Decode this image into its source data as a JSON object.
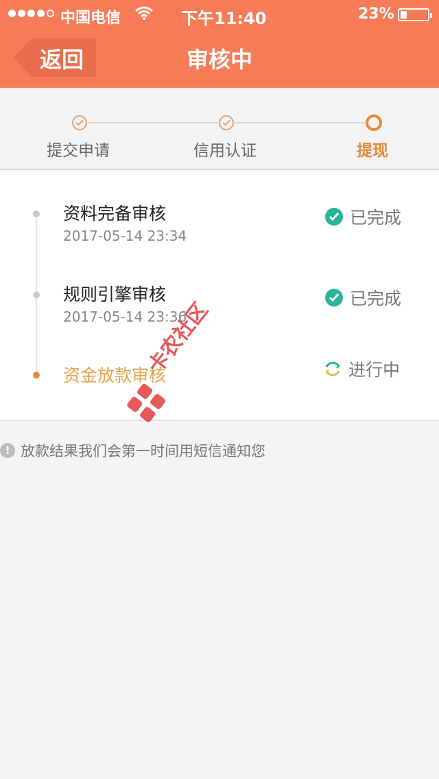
{
  "status_bar": {
    "carrier": "中国电信",
    "time": "下午11:40",
    "battery_pct": "23%",
    "battery_level": 0.23,
    "signal_bars": 4,
    "signal_total": 5
  },
  "nav": {
    "back_label": "返回",
    "title": "审核中"
  },
  "steps": [
    {
      "label": "提交申请",
      "state": "done"
    },
    {
      "label": "信用认证",
      "state": "done"
    },
    {
      "label": "提现",
      "state": "current"
    }
  ],
  "timeline": [
    {
      "title": "资料完备审核",
      "time": "2017-05-14 23:34",
      "status": "已完成",
      "state": "done"
    },
    {
      "title": "规则引擎审核",
      "time": "2017-05-14 23:36",
      "status": "已完成",
      "state": "done"
    },
    {
      "title": "资金放款审核",
      "time": "",
      "status": "进行中",
      "state": "in_progress"
    }
  ],
  "notice": {
    "icon": "info-icon",
    "text": "放款结果我们会第一时间用短信通知您"
  },
  "watermark": {
    "text": "卡农社区"
  },
  "colors": {
    "header": "#f87b57",
    "accent": "#e58a35",
    "success": "#2bb39c"
  }
}
